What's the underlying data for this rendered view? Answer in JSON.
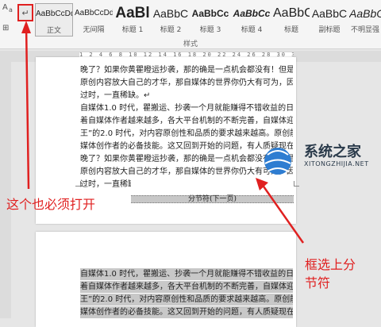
{
  "ribbon": {
    "tool_glyphs": [
      "A",
      "a",
      "⊞"
    ],
    "show_marks_glyph": "↵",
    "styles": [
      {
        "sample": "AaBbCcDd",
        "name": "正文"
      },
      {
        "sample": "AaBbCcDd",
        "name": "无间隔"
      },
      {
        "sample": "AaBl",
        "name": "标题 1"
      },
      {
        "sample": "AaBbC",
        "name": "标题 2"
      },
      {
        "sample": "AaBbCc",
        "name": "标题 3"
      },
      {
        "sample": "AaBbCc",
        "name": "标题 4"
      },
      {
        "sample": "AaBbC",
        "name": "标题"
      },
      {
        "sample": "AaBbC",
        "name": "副标题"
      },
      {
        "sample": "AaBbC",
        "name": "不明显强"
      }
    ],
    "styles_group_label": "样式"
  },
  "ruler": {
    "numbers": "1 2 4 6 8 10 12 14 16 18 20 22 24 26 28 30 32 34 36"
  },
  "page1": {
    "lines": [
      "晚了？如果你黄瞿瞪运抄袭，那的确是一点机会都没有！但是，如果你黄瞿",
      "原创内容放大自己的才华，那自媒体的世界你仍大有可为，因为原创内容永不",
      "过时，一直稀缺。↵",
      "自媒体1.0 时代，瞿搬运、抄袭一个月就能赚得不错收益的日子早已不在。随",
      "着自媒体作者越来越多，各大平台机制的不断完善，自媒体迎来了“内容为",
      "王”的2.0 时代，对内容原创性和品质的要求越来越高。原创能力早已成为自",
      "媒体创作者的必备技能。这又回到开始的问题，有人质疑现在做自媒体是不是",
      "晚了？如果你黄瞿瞪运抄袭，那的确是一点机会都没有！但是，如果你黄瞿",
      "原创内容放大自己的才华，那自媒体的世界你仍大有可为，因为原创内容永不",
      "过时，一直稀缺。"
    ],
    "section_break": "分节符(下一页)"
  },
  "page2": {
    "lines": [
      "自媒体1.0 时代，瞿搬运、抄袭一个月就能赚得不错收益的日子早已不在。随",
      "着自媒体作者越来越多，各大平台机制的不断完善，自媒体迎来了“内容为",
      "王”的2.0 时代，对内容原创性和品质的要求越来越高。原创能力早已成为自",
      "媒体创作者的必备技能。这又回到开始的问题，有人质疑现在做自媒体是不是"
    ]
  },
  "annotations": {
    "must_enable": "这个也必须打开",
    "select_break_line1": "框选上分",
    "select_break_line2": "节符"
  },
  "watermark": {
    "brand": "系统之家",
    "url": "XITONGZHIJIA.NET"
  },
  "colors": {
    "annotation": "#e02020",
    "selection": "#c8c8c8"
  }
}
